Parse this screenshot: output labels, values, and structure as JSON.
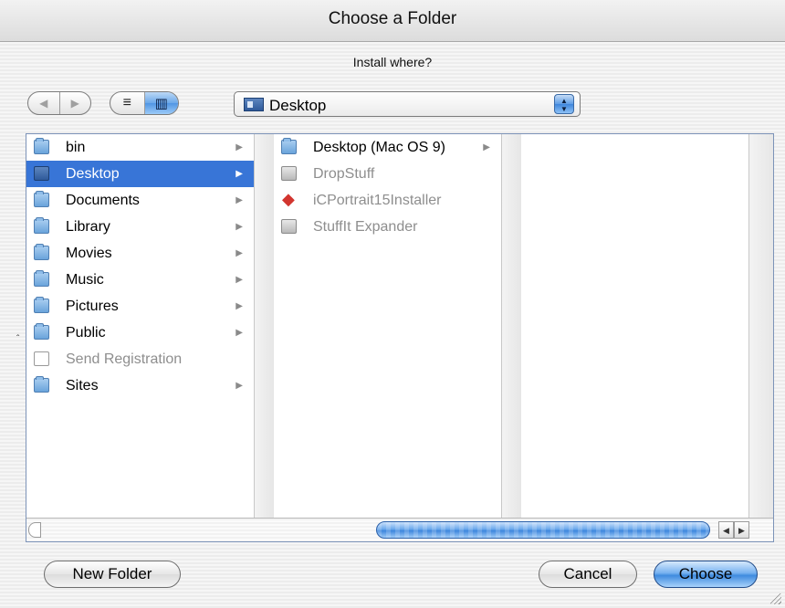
{
  "window": {
    "title": "Choose a Folder",
    "prompt": "Install where?"
  },
  "toolbar": {
    "back_icon": "◀",
    "forward_icon": "▶",
    "list_view_icon": "≡",
    "column_view_icon": "▥",
    "location": "Desktop",
    "popup_arrows": "▲\n▼"
  },
  "columns": [
    {
      "items": [
        {
          "label": "bin",
          "icon": "folder-icon",
          "has_children": true
        },
        {
          "label": "Desktop",
          "icon": "desktop-folder-icon",
          "has_children": true,
          "selected": true
        },
        {
          "label": "Documents",
          "icon": "folder-icon",
          "has_children": true
        },
        {
          "label": "Library",
          "icon": "library-folder-icon",
          "has_children": true
        },
        {
          "label": "Movies",
          "icon": "movies-folder-icon",
          "has_children": true
        },
        {
          "label": "Music",
          "icon": "music-folder-icon",
          "has_children": true
        },
        {
          "label": "Pictures",
          "icon": "pictures-folder-icon",
          "has_children": true
        },
        {
          "label": "Public",
          "icon": "public-folder-icon",
          "has_children": true
        },
        {
          "label": "Send Registration",
          "icon": "document-icon",
          "has_children": false,
          "disabled": true
        },
        {
          "label": "Sites",
          "icon": "folder-icon",
          "has_children": true
        }
      ]
    },
    {
      "items": [
        {
          "label": "Desktop (Mac OS 9)",
          "icon": "folder-icon",
          "has_children": true
        },
        {
          "label": "DropStuff",
          "icon": "app-icon",
          "has_children": false,
          "disabled": true
        },
        {
          "label": "iCPortrait15Installer",
          "icon": "installer-icon",
          "has_children": false,
          "disabled": true
        },
        {
          "label": "StuffIt Expander",
          "icon": "app-icon",
          "has_children": false,
          "disabled": true
        }
      ]
    },
    {
      "items": []
    }
  ],
  "arrow_glyph": "▶",
  "scrollbar": {
    "left_icon": "◀",
    "right_icon": "▶"
  },
  "buttons": {
    "new_folder": "New Folder",
    "cancel": "Cancel",
    "choose": "Choose"
  },
  "colors": {
    "selection": "#3875d7",
    "accent": "#3f8bdf"
  }
}
